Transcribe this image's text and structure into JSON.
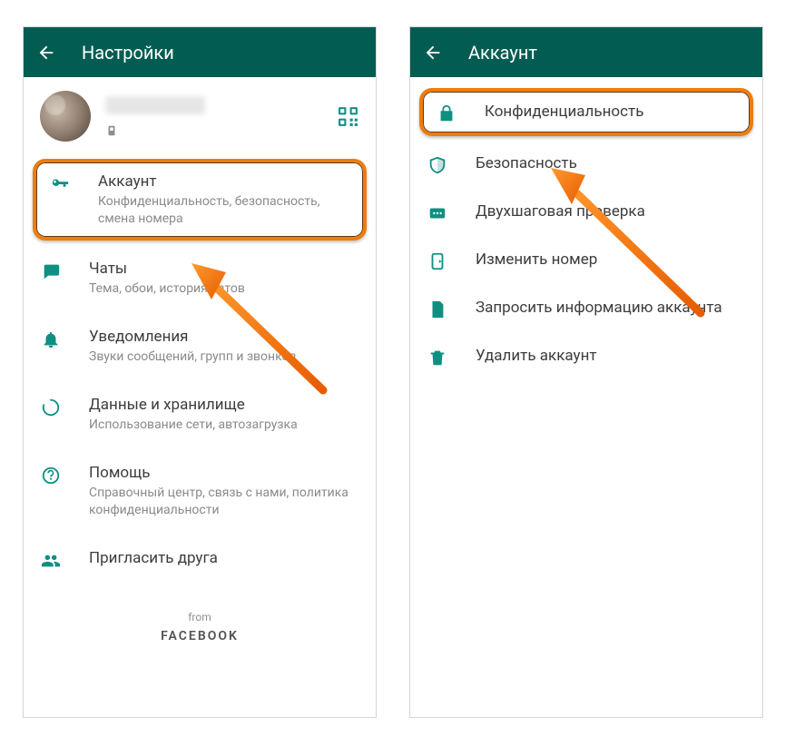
{
  "left": {
    "header_title": "Настройки",
    "profile_name_blurred": true,
    "items": {
      "account": {
        "title": "Аккаунт",
        "sub": "Конфиденциальность, безопасность, смена номера"
      },
      "chats": {
        "title": "Чаты",
        "sub": "Тема, обои, история чатов"
      },
      "notifs": {
        "title": "Уведомления",
        "sub": "Звуки сообщений, групп и звонков"
      },
      "data": {
        "title": "Данные и хранилище",
        "sub": "Использование сети, автозагрузка"
      },
      "help": {
        "title": "Помощь",
        "sub": "Справочный центр, связь с нами, политика конфиденциальности"
      },
      "invite": {
        "title": "Пригласить друга"
      }
    },
    "footer_from": "from",
    "footer_brand": "FACEBOOK"
  },
  "right": {
    "header_title": "Аккаунт",
    "items": {
      "privacy": {
        "title": "Конфиденциальность"
      },
      "security": {
        "title": "Безопасность"
      },
      "twostep": {
        "title": "Двухшаговая проверка"
      },
      "change": {
        "title": "Изменить номер"
      },
      "request": {
        "title": "Запросить информацию аккаунта"
      },
      "delete": {
        "title": "Удалить аккаунт"
      }
    }
  }
}
